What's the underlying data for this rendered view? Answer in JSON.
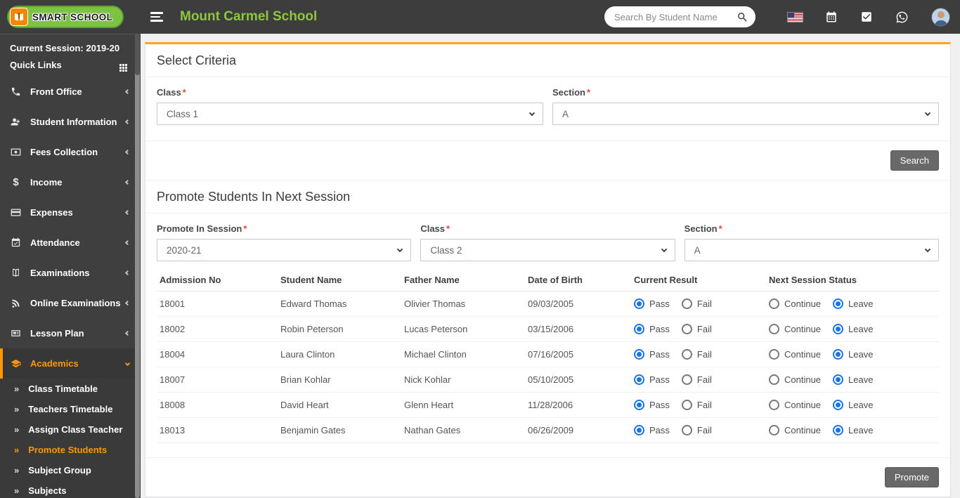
{
  "header": {
    "logo_text": "SMART SCHOOL",
    "school_name": "Mount Carmel School",
    "search_placeholder": "Search By Student Name"
  },
  "sidebar": {
    "current_session": "Current Session: 2019-20",
    "quick_links": "Quick Links",
    "items": [
      {
        "label": "Front Office",
        "icon": "front-office-icon"
      },
      {
        "label": "Student Information",
        "icon": "student-information-icon"
      },
      {
        "label": "Fees Collection",
        "icon": "fees-collection-icon"
      },
      {
        "label": "Income",
        "icon": "income-icon"
      },
      {
        "label": "Expenses",
        "icon": "expenses-icon"
      },
      {
        "label": "Attendance",
        "icon": "attendance-icon"
      },
      {
        "label": "Examinations",
        "icon": "examinations-icon"
      },
      {
        "label": "Online Examinations",
        "icon": "online-examinations-icon"
      },
      {
        "label": "Lesson Plan",
        "icon": "lesson-plan-icon"
      }
    ],
    "academics": {
      "label": "Academics",
      "icon": "graduation-cap-icon",
      "expanded": true
    },
    "subitems": [
      {
        "label": "Class Timetable",
        "active": false
      },
      {
        "label": "Teachers Timetable",
        "active": false
      },
      {
        "label": "Assign Class Teacher",
        "active": false
      },
      {
        "label": "Promote Students",
        "active": true
      },
      {
        "label": "Subject Group",
        "active": false
      },
      {
        "label": "Subjects",
        "active": false
      }
    ]
  },
  "required_marker": "*",
  "criteria": {
    "title": "Select Criteria",
    "class_label": "Class",
    "class_value": "Class 1",
    "section_label": "Section",
    "section_value": "A",
    "search_button": "Search"
  },
  "promote": {
    "title": "Promote Students In Next Session",
    "session_label": "Promote In Session",
    "session_value": "2020-21",
    "class_label": "Class",
    "class_value": "Class 2",
    "section_label": "Section",
    "section_value": "A",
    "promote_button": "Promote",
    "table": {
      "headers": [
        "Admission No",
        "Student Name",
        "Father Name",
        "Date of Birth",
        "Current Result",
        "Next Session Status"
      ],
      "result_options": [
        "Pass",
        "Fail"
      ],
      "status_options": [
        "Continue",
        "Leave"
      ],
      "rows": [
        {
          "admission_no": "18001",
          "student_name": "Edward Thomas",
          "father_name": "Olivier Thomas",
          "dob": "09/03/2005",
          "current_result": "Pass",
          "next_session_status": "Leave"
        },
        {
          "admission_no": "18002",
          "student_name": "Robin Peterson",
          "father_name": "Lucas Peterson",
          "dob": "03/15/2006",
          "current_result": "Pass",
          "next_session_status": "Leave"
        },
        {
          "admission_no": "18004",
          "student_name": "Laura Clinton",
          "father_name": "Michael Clinton",
          "dob": "07/16/2005",
          "current_result": "Pass",
          "next_session_status": "Leave"
        },
        {
          "admission_no": "18007",
          "student_name": "Brian Kohlar",
          "father_name": "Nick Kohlar",
          "dob": "05/10/2005",
          "current_result": "Pass",
          "next_session_status": "Leave"
        },
        {
          "admission_no": "18008",
          "student_name": "David Heart",
          "father_name": "Glenn Heart",
          "dob": "11/28/2006",
          "current_result": "Pass",
          "next_session_status": "Leave"
        },
        {
          "admission_no": "18013",
          "student_name": "Benjamin Gates",
          "father_name": "Nathan Gates",
          "dob": "06/26/2009",
          "current_result": "Pass",
          "next_session_status": "Leave"
        }
      ]
    }
  },
  "colors": {
    "header_bg": "#3d3d3d",
    "sidebar_bg": "#3f3f3f",
    "accent_orange": "#ff9800",
    "card_top_border": "#ffa21f",
    "brand_green": "#8dc63f",
    "radio_selected_blue": "#1a73e8",
    "button_gray": "#696969",
    "required_red": "#f44336"
  }
}
